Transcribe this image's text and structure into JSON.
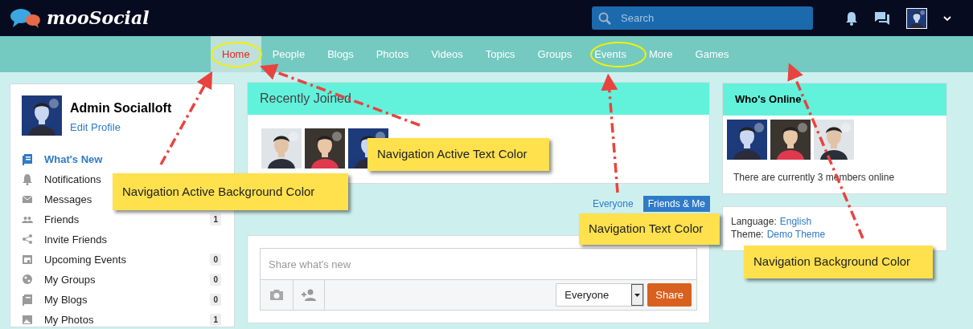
{
  "header": {
    "logo": "mooSocial",
    "search": {
      "placeholder": "Search"
    }
  },
  "nav": [
    {
      "label": "Home",
      "selected": true
    },
    {
      "label": "People",
      "selected": false
    },
    {
      "label": "Blogs",
      "selected": false
    },
    {
      "label": "Photos",
      "selected": false
    },
    {
      "label": "Videos",
      "selected": false
    },
    {
      "label": "Topics",
      "selected": false
    },
    {
      "label": "Groups",
      "selected": false
    },
    {
      "label": "Events",
      "selected": false
    },
    {
      "label": "More",
      "selected": false
    },
    {
      "label": "Games",
      "selected": false
    }
  ],
  "profile": {
    "name": "Admin Socialloft",
    "edit_link": "Edit Profile"
  },
  "menu": [
    {
      "label": "What's New",
      "selected": true
    },
    {
      "label": "Notifications",
      "selected": false
    },
    {
      "label": "Messages",
      "selected": false
    },
    {
      "label": "Friends",
      "selected": false,
      "count": "1"
    },
    {
      "label": "Invite Friends",
      "selected": false
    },
    {
      "label": "Upcoming Events",
      "selected": false,
      "count": "0"
    },
    {
      "label": "My Groups",
      "selected": false,
      "count": "0"
    },
    {
      "label": "My Blogs",
      "selected": false,
      "count": "0"
    },
    {
      "label": "My Photos",
      "selected": false,
      "count": "1"
    }
  ],
  "recently_joined": {
    "title": "Recently Joined"
  },
  "feed_filter": [
    {
      "label": "Everyone",
      "selected": false
    },
    {
      "label": "Friends & Me",
      "selected": true
    }
  ],
  "composer": {
    "placeholder": "Share what's new",
    "privacy": "Everyone",
    "share_button": "Share"
  },
  "whos_online": {
    "title": "Who's Online",
    "summary": "There are currently 3 members online"
  },
  "settings": [
    {
      "label": "Language:",
      "value": "English"
    },
    {
      "label": "Theme:",
      "value": "Demo Theme"
    }
  ],
  "annotations": [
    {
      "text": "Navigation Active Background Color"
    },
    {
      "text": "Navigation Active Text Color"
    },
    {
      "text": "Navigation Text Color"
    },
    {
      "text": "Navigation Background Color"
    }
  ]
}
